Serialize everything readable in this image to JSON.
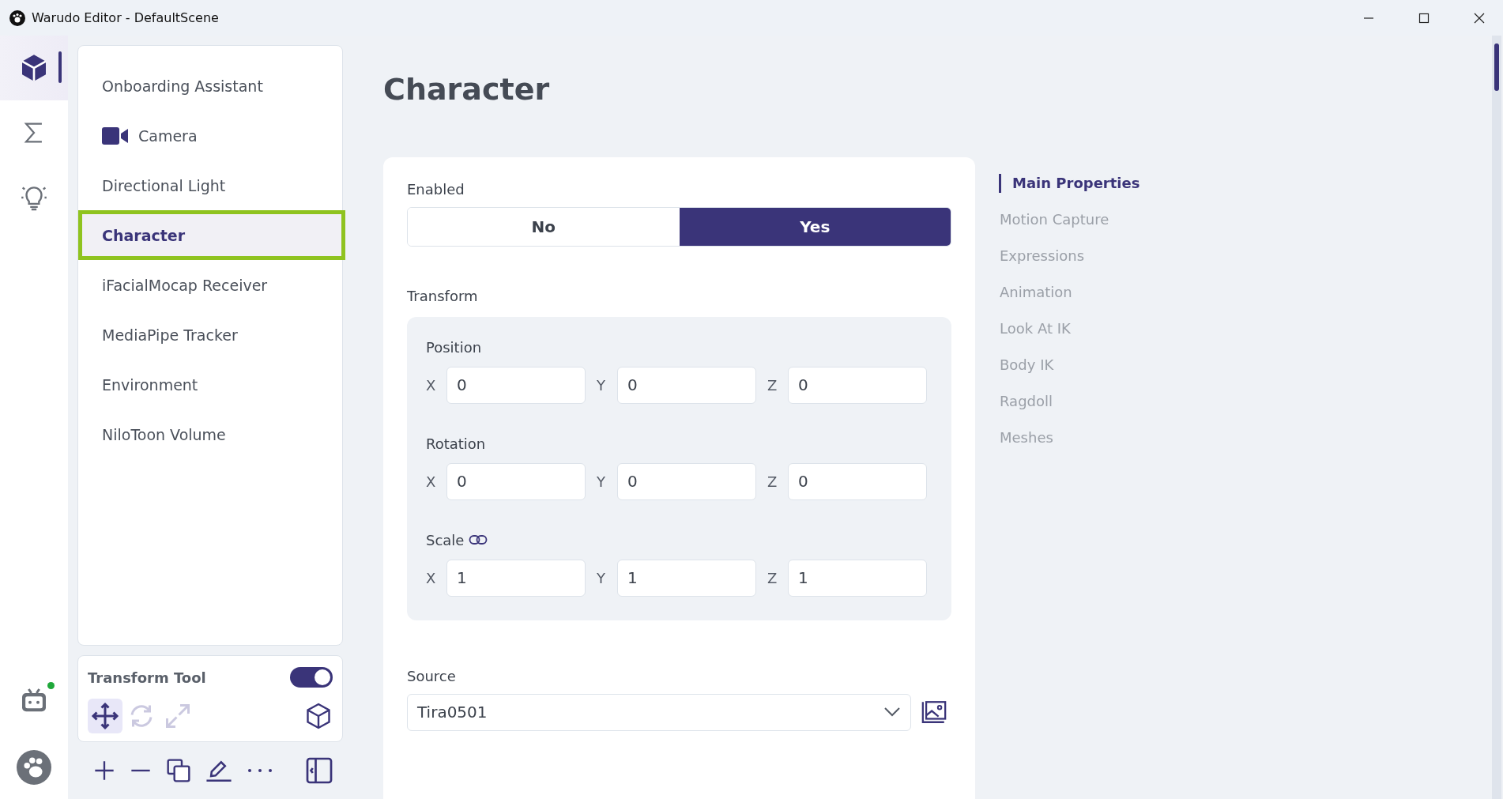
{
  "window": {
    "title": "Warudo Editor - DefaultScene"
  },
  "rail": {
    "items": [
      {
        "selected": true
      },
      {
        "selected": false
      },
      {
        "selected": false
      }
    ],
    "status": {
      "online": true
    }
  },
  "sidebar": {
    "items": [
      {
        "label": "Onboarding Assistant",
        "kind": "text",
        "selected": false
      },
      {
        "label": "Camera",
        "kind": "camera",
        "selected": false
      },
      {
        "label": "Directional Light",
        "kind": "text",
        "selected": false
      },
      {
        "label": "Character",
        "kind": "text",
        "selected": true
      },
      {
        "label": "iFacialMocap Receiver",
        "kind": "text",
        "selected": false
      },
      {
        "label": "MediaPipe Tracker",
        "kind": "text",
        "selected": false
      },
      {
        "label": "Environment",
        "kind": "text",
        "selected": false
      },
      {
        "label": "NiloToon Volume",
        "kind": "text",
        "selected": false
      }
    ]
  },
  "transform_tool": {
    "label": "Transform Tool",
    "on": true,
    "tools": [
      {
        "selected": true
      },
      {
        "selected": false
      },
      {
        "selected": false
      }
    ]
  },
  "main": {
    "heading": "Character",
    "enabled": {
      "label": "Enabled",
      "options": [
        {
          "label": "No",
          "selected": false
        },
        {
          "label": "Yes",
          "selected": true
        }
      ]
    },
    "transform": {
      "label": "Transform",
      "groups": [
        {
          "label": "Position",
          "linked": false,
          "fields": [
            {
              "axis": "X",
              "value": "0"
            },
            {
              "axis": "Y",
              "value": "0"
            },
            {
              "axis": "Z",
              "value": "0"
            }
          ]
        },
        {
          "label": "Rotation",
          "linked": false,
          "fields": [
            {
              "axis": "X",
              "value": "0"
            },
            {
              "axis": "Y",
              "value": "0"
            },
            {
              "axis": "Z",
              "value": "0"
            }
          ]
        },
        {
          "label": "Scale",
          "linked": true,
          "fields": [
            {
              "axis": "X",
              "value": "1"
            },
            {
              "axis": "Y",
              "value": "1"
            },
            {
              "axis": "Z",
              "value": "1"
            }
          ]
        }
      ]
    },
    "source": {
      "label": "Source",
      "value": "Tira0501"
    }
  },
  "nav": {
    "items": [
      {
        "label": "Main Properties",
        "selected": true
      },
      {
        "label": "Motion Capture",
        "selected": false
      },
      {
        "label": "Expressions",
        "selected": false
      },
      {
        "label": "Animation",
        "selected": false
      },
      {
        "label": "Look At IK",
        "selected": false
      },
      {
        "label": "Body IK",
        "selected": false
      },
      {
        "label": "Ragdoll",
        "selected": false
      },
      {
        "label": "Meshes",
        "selected": false
      }
    ]
  }
}
